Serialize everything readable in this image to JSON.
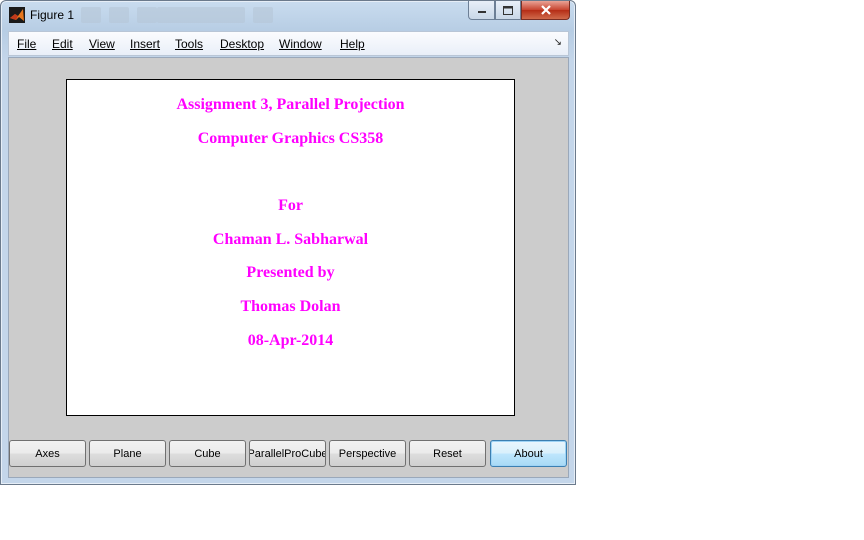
{
  "window": {
    "title": "Figure 1",
    "controls": {
      "minimize": "minimize-icon",
      "maximize": "maximize-icon",
      "close": "close-icon"
    }
  },
  "menu": {
    "items": [
      {
        "label": "File"
      },
      {
        "label": "Edit"
      },
      {
        "label": "View"
      },
      {
        "label": "Insert"
      },
      {
        "label": "Tools"
      },
      {
        "label": "Desktop"
      },
      {
        "label": "Window"
      },
      {
        "label": "Help"
      }
    ],
    "dock_icon": "dock-arrow-icon"
  },
  "figure": {
    "text_color": "#ff00ff",
    "lines": [
      "Assignment 3, Parallel Projection",
      "Computer Graphics CS358",
      "For",
      "Chaman L. Sabharwal",
      "Presented by",
      "Thomas Dolan",
      "08-Apr-2014"
    ]
  },
  "buttons": [
    {
      "label": "Axes"
    },
    {
      "label": "Plane"
    },
    {
      "label": "Cube"
    },
    {
      "label": "ParallelProCube"
    },
    {
      "label": "Perspective"
    },
    {
      "label": "Reset"
    },
    {
      "label": "About"
    }
  ]
}
